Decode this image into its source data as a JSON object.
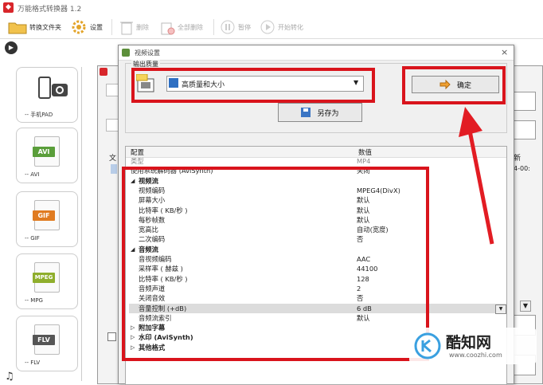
{
  "app": {
    "title": "万能格式转换器 1.2",
    "logo": "◆"
  },
  "toolbar": {
    "convert_folder": "转换文件夹",
    "settings": "设置",
    "delete": "删除",
    "delete_all": "全部删除",
    "pause": "暂停",
    "start": "开始转化"
  },
  "sidebar": [
    {
      "label": "-- 手机PAD",
      "badge": "",
      "color": ""
    },
    {
      "label": "-- AVI",
      "badge": "AVI",
      "color": "#5a9e3a"
    },
    {
      "label": "-- GIF",
      "badge": "GIF",
      "color": "#e07b21"
    },
    {
      "label": "-- MPG",
      "badge": "MPEG",
      "color": "#8fae2c"
    },
    {
      "label": "-- FLV",
      "badge": "FLV",
      "color": "#555555"
    }
  ],
  "bg_dialog": {
    "col_a": "文",
    "col_b": "新",
    "cell": "4-00:"
  },
  "dialog": {
    "title": "视频设置",
    "group_label": "输出质量",
    "quality_selected": "高质量和大小",
    "ok": "确定",
    "save_as": "另存为",
    "col_config": "配置",
    "col_value": "数值"
  },
  "rows": [
    {
      "name": "类型",
      "value": "MP4",
      "indent": 0,
      "bold": false,
      "partial": true
    },
    {
      "name": "使用系统解码器 (AviSynth)",
      "value": "关闭",
      "indent": 0,
      "bold": false
    },
    {
      "name": "视频流",
      "value": "",
      "indent": 1,
      "bold": true,
      "section": true
    },
    {
      "name": "视频编码",
      "value": "MPEG4(DivX)",
      "indent": 2,
      "bold": false
    },
    {
      "name": "屏幕大小",
      "value": "默认",
      "indent": 2,
      "bold": false
    },
    {
      "name": "比特率 ( KB/秒 )",
      "value": "默认",
      "indent": 2,
      "bold": false
    },
    {
      "name": "每秒帧数",
      "value": "默认",
      "indent": 2,
      "bold": false
    },
    {
      "name": "宽高比",
      "value": "自动(宽度)",
      "indent": 2,
      "bold": false
    },
    {
      "name": "二次编码",
      "value": "否",
      "indent": 2,
      "bold": false
    },
    {
      "name": "音频流",
      "value": "",
      "indent": 1,
      "bold": true,
      "section": true
    },
    {
      "name": "音视频编码",
      "value": "AAC",
      "indent": 2,
      "bold": false
    },
    {
      "name": "采样率 ( 赫兹 )",
      "value": "44100",
      "indent": 2,
      "bold": false
    },
    {
      "name": "比特率 ( KB/秒 )",
      "value": "128",
      "indent": 2,
      "bold": false
    },
    {
      "name": "音频声道",
      "value": "2",
      "indent": 2,
      "bold": false
    },
    {
      "name": "关闭音效",
      "value": "否",
      "indent": 2,
      "bold": false
    },
    {
      "name": "音量控制 (+dB)",
      "value": "6 dB",
      "indent": 2,
      "bold": false,
      "dropdown": true
    },
    {
      "name": "音频流索引",
      "value": "默认",
      "indent": 2,
      "bold": false
    },
    {
      "name": "附加字幕",
      "value": "",
      "indent": 1,
      "bold": true,
      "collapsed": true
    },
    {
      "name": "水印 (AviSynth)",
      "value": "",
      "indent": 1,
      "bold": true,
      "collapsed": true
    },
    {
      "name": "其他格式",
      "value": "",
      "indent": 1,
      "bold": true,
      "collapsed": true
    }
  ],
  "watermark": {
    "brand": "酷知网",
    "url": "www.coozhi.com"
  },
  "colors": {
    "highlight": "#d9141c",
    "brand": "#d8262b",
    "arrow": "#e21c23"
  }
}
